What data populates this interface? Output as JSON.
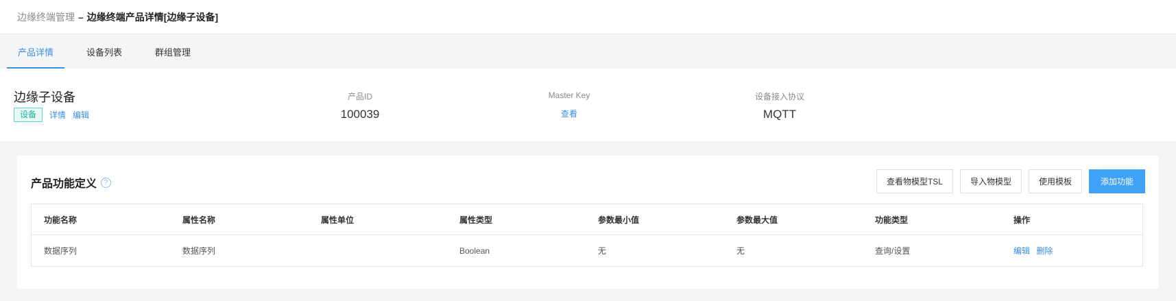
{
  "breadcrumb": {
    "parent": "边缘终端管理",
    "separator": "–",
    "current": "边缘终端产品详情[边缘子设备]"
  },
  "tabs": [
    {
      "label": "产品详情",
      "active": true
    },
    {
      "label": "设备列表",
      "active": false
    },
    {
      "label": "群组管理",
      "active": false
    }
  ],
  "product": {
    "name": "边缘子设备",
    "tag": "设备",
    "detail_link": "详情",
    "edit_link": "编辑",
    "id_label": "产品ID",
    "id_value": "100039",
    "master_key_label": "Master Key",
    "master_key_action": "查看",
    "protocol_label": "设备接入协议",
    "protocol_value": "MQTT"
  },
  "functions": {
    "title": "产品功能定义",
    "help_icon": "question-circle-icon",
    "buttons": {
      "view_tsl": "查看物模型TSL",
      "import_model": "导入物模型",
      "use_template": "使用模板",
      "add_function": "添加功能"
    },
    "columns": [
      "功能名称",
      "属性名称",
      "属性单位",
      "属性类型",
      "参数最小值",
      "参数最大值",
      "功能类型",
      "操作"
    ],
    "rows": [
      {
        "function_name": "数据序列",
        "property_name": "数据序列",
        "property_unit": "",
        "property_type": "Boolean",
        "min_value": "无",
        "max_value": "无",
        "function_type": "查询/设置",
        "edit": "编辑",
        "delete": "删除"
      }
    ]
  },
  "colors": {
    "accent": "#3a8ee6",
    "primary_button": "#3fa1f8",
    "tag_border": "#5fd3c4"
  }
}
